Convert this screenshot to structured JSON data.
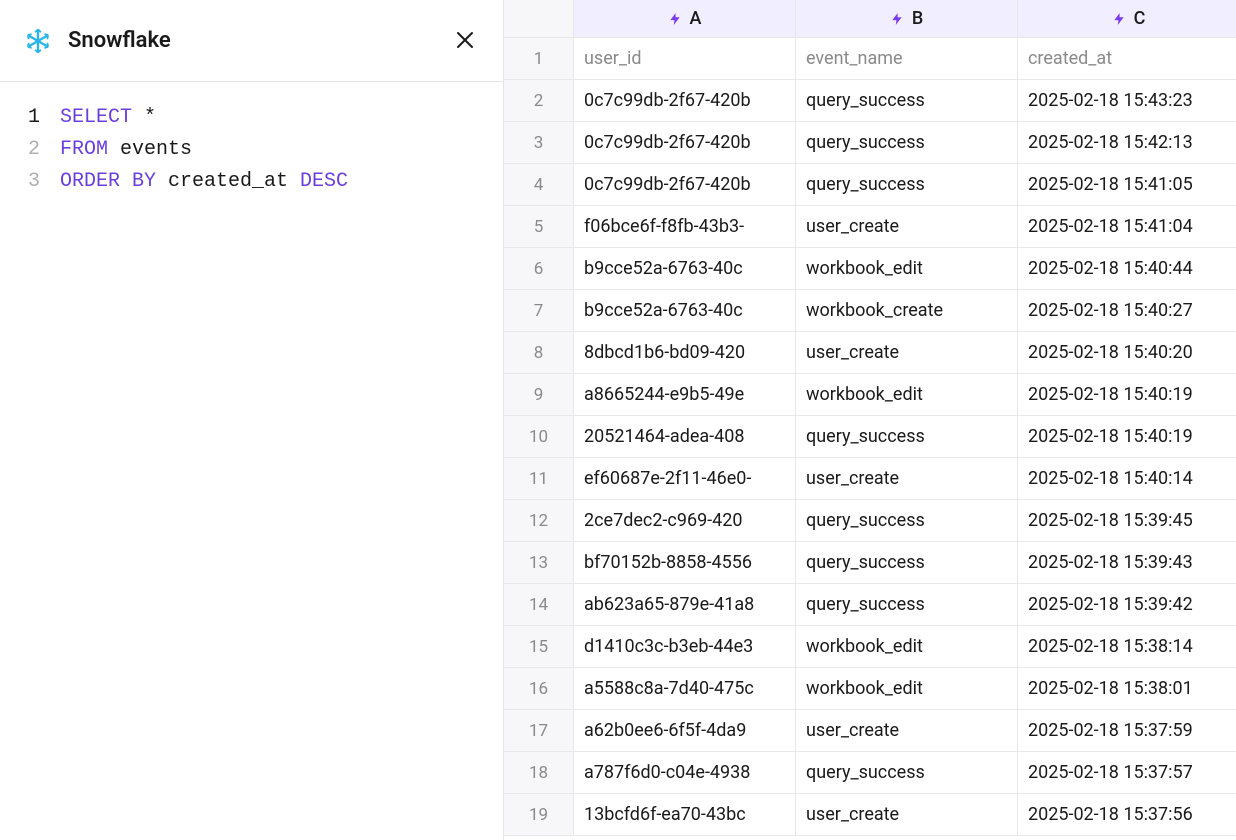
{
  "panel": {
    "title": "Snowflake"
  },
  "code": {
    "lines": [
      {
        "num": "1",
        "active": true,
        "tokens": [
          {
            "t": "SELECT",
            "c": "kw"
          },
          {
            "t": " *",
            "c": "id"
          }
        ]
      },
      {
        "num": "2",
        "active": false,
        "tokens": [
          {
            "t": "FROM",
            "c": "kw"
          },
          {
            "t": " events",
            "c": "id"
          }
        ]
      },
      {
        "num": "3",
        "active": false,
        "tokens": [
          {
            "t": "ORDER BY",
            "c": "kw"
          },
          {
            "t": " created_at ",
            "c": "id"
          },
          {
            "t": "DESC",
            "c": "kw"
          }
        ]
      }
    ]
  },
  "table": {
    "columns": [
      "A",
      "B",
      "C"
    ],
    "field_headers": [
      "user_id",
      "event_name",
      "created_at"
    ],
    "rows": [
      [
        "0c7c99db-2f67-420b",
        "query_success",
        "2025-02-18 15:43:23"
      ],
      [
        "0c7c99db-2f67-420b",
        "query_success",
        "2025-02-18 15:42:13"
      ],
      [
        "0c7c99db-2f67-420b",
        "query_success",
        "2025-02-18 15:41:05"
      ],
      [
        "f06bce6f-f8fb-43b3-",
        "user_create",
        "2025-02-18 15:41:04"
      ],
      [
        "b9cce52a-6763-40c",
        "workbook_edit",
        "2025-02-18 15:40:44"
      ],
      [
        "b9cce52a-6763-40c",
        "workbook_create",
        "2025-02-18 15:40:27"
      ],
      [
        "8dbcd1b6-bd09-420",
        "user_create",
        "2025-02-18 15:40:20"
      ],
      [
        "a8665244-e9b5-49e",
        "workbook_edit",
        "2025-02-18 15:40:19"
      ],
      [
        "20521464-adea-408",
        "query_success",
        "2025-02-18 15:40:19"
      ],
      [
        "ef60687e-2f11-46e0-",
        "user_create",
        "2025-02-18 15:40:14"
      ],
      [
        "2ce7dec2-c969-420",
        "query_success",
        "2025-02-18 15:39:45"
      ],
      [
        "bf70152b-8858-4556",
        "query_success",
        "2025-02-18 15:39:43"
      ],
      [
        "ab623a65-879e-41a8",
        "query_success",
        "2025-02-18 15:39:42"
      ],
      [
        "d1410c3c-b3eb-44e3",
        "workbook_edit",
        "2025-02-18 15:38:14"
      ],
      [
        "a5588c8a-7d40-475c",
        "workbook_edit",
        "2025-02-18 15:38:01"
      ],
      [
        "a62b0ee6-6f5f-4da9",
        "user_create",
        "2025-02-18 15:37:59"
      ],
      [
        "a787f6d0-c04e-4938",
        "query_success",
        "2025-02-18 15:37:57"
      ],
      [
        "13bcfd6f-ea70-43bc",
        "user_create",
        "2025-02-18 15:37:56"
      ]
    ]
  }
}
